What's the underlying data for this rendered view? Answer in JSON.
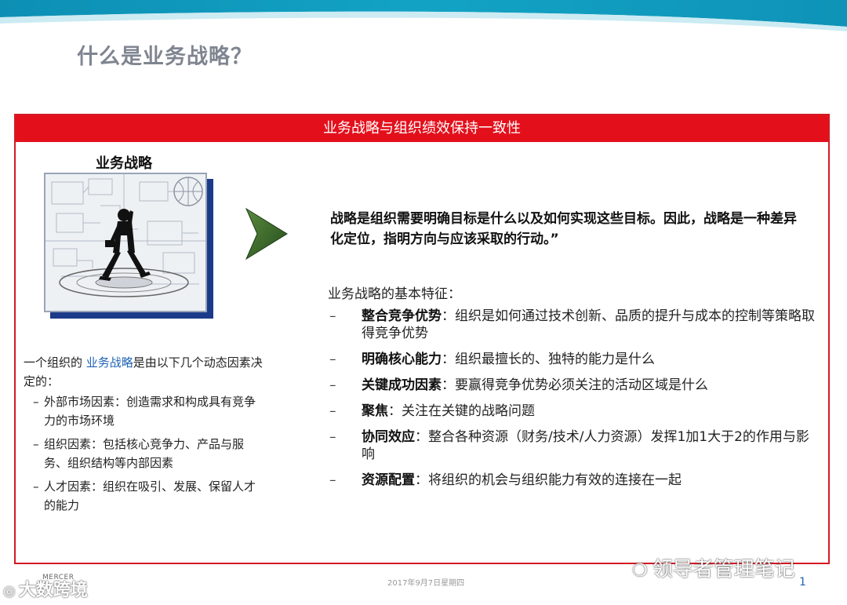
{
  "slide": {
    "title": "什么是业务战略？",
    "frame_header": "业务战略与组织绩效保持一致性",
    "strategy_label": "业务战略",
    "quote": "战略是组织需要明确目标是什么以及如何实现这些目标。因此，战略是一种差异化定位，指明方向与应该采取的行动。”",
    "features_title": "业务战略的基本特征：",
    "features": [
      {
        "dash": "–",
        "term": "整合竞争优势",
        "text": "：组织是如何通过技术创新、品质的提升与成本的控制等策略取得竞争优势"
      },
      {
        "dash": "–",
        "term": "明确核心能力",
        "text": "：组织最擅长的、独特的能力是什么"
      },
      {
        "dash": "–",
        "term": "关键成功因素",
        "text": "：要赢得竞争优势必须关注的活动区域是什么"
      },
      {
        "dash": "–",
        "term": "聚焦",
        "text": "：关注在关键的战略问题"
      },
      {
        "dash": "–",
        "term": "协同效应",
        "text": "：整合各种资源（财务/技术/人力资源）发挥1加1大于2的作用与影响"
      },
      {
        "dash": "–",
        "term": "资源配置",
        "text": "：将组织的机会与组织能力有效的连接在一起"
      }
    ],
    "left_intro_pre": "一个组织的 ",
    "left_intro_highlight": "业务战略",
    "left_intro_post": "是由以下几个动态因素决定的：",
    "left_items": [
      {
        "dash": "–",
        "text": "外部市场因素：创造需求和构成具有竞争力的市场环境"
      },
      {
        "dash": "–",
        "text": "组织因素：包括核心竞争力、产品与服务、组织结构等内部因素"
      },
      {
        "dash": "–",
        "text": "人才因素：组织在吸引、发展、保留人才的能力"
      }
    ]
  },
  "footer": {
    "date": "2017年9月7日星期四",
    "brand": "MERCER",
    "watermark_left": "大数跨境",
    "watermark_right": "领导者管理笔记",
    "page_number": "1"
  },
  "colors": {
    "frame_red": "#e3101c",
    "highlight_blue": "#1f63b5",
    "title_gray": "#7f8590",
    "arrow_green": "#3d6b2c",
    "band_teal": "#12a3c4"
  },
  "icons": {
    "arrow": "chevron-right-icon",
    "photo": "businessman-photo",
    "watermark_left": "weibo-icon",
    "watermark_right": "wechat-icon"
  }
}
